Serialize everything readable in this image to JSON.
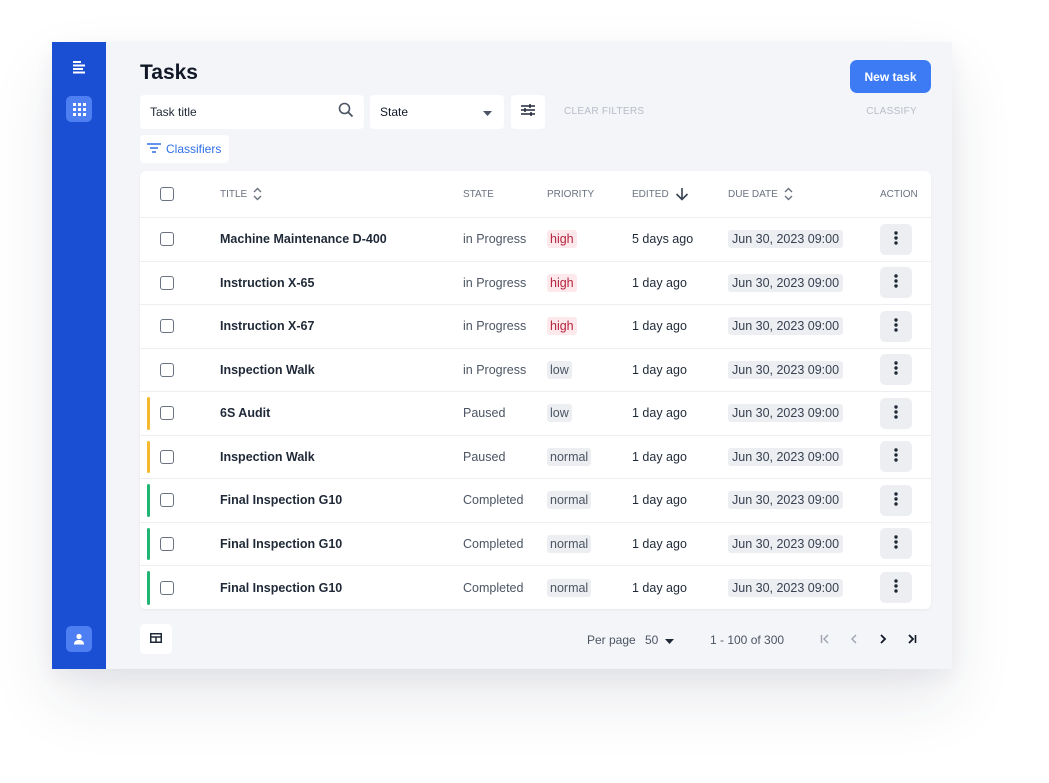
{
  "app": {
    "page_title": "Tasks",
    "new_task_label": "New task",
    "colors": {
      "accent": "#3d7bf5",
      "sidebar": "#1a4fd3",
      "paused": "#f5b82e",
      "completed": "#21b573"
    }
  },
  "sidebar": {
    "icons": [
      "menu-icon",
      "apps-icon",
      "user-icon"
    ]
  },
  "toolbar": {
    "search_placeholder": "Task title",
    "state_select_value": "State",
    "clear_filters_label": "CLEAR FILTERS",
    "classify_label": "CLASSIFY",
    "classifiers_label": "Classifiers"
  },
  "table": {
    "headers": {
      "title": "TITLE",
      "state": "STATE",
      "priority": "PRIORITY",
      "edited": "EDITED",
      "due_date": "DUE DATE",
      "action": "ACTION"
    },
    "rows": [
      {
        "title": "Machine Maintenance D-400",
        "state": "in Progress",
        "priority": "high",
        "edited": "5 days ago",
        "due": "Jun 30, 2023 09:00",
        "status": ""
      },
      {
        "title": "Instruction X-65",
        "state": "in Progress",
        "priority": "high",
        "edited": "1 day ago",
        "due": "Jun 30, 2023 09:00",
        "status": ""
      },
      {
        "title": "Instruction X-67",
        "state": "in Progress",
        "priority": "high",
        "edited": "1 day ago",
        "due": "Jun 30, 2023 09:00",
        "status": ""
      },
      {
        "title": "Inspection Walk",
        "state": "in Progress",
        "priority": "low",
        "edited": "1 day ago",
        "due": "Jun 30, 2023 09:00",
        "status": ""
      },
      {
        "title": "6S Audit",
        "state": "Paused",
        "priority": "low",
        "edited": "1 day ago",
        "due": "Jun 30, 2023 09:00",
        "status": "paused"
      },
      {
        "title": "Inspection Walk",
        "state": "Paused",
        "priority": "normal",
        "edited": "1 day ago",
        "due": "Jun 30, 2023 09:00",
        "status": "paused"
      },
      {
        "title": "Final Inspection G10",
        "state": "Completed",
        "priority": "normal",
        "edited": "1 day ago",
        "due": "Jun 30, 2023 09:00",
        "status": "completed"
      },
      {
        "title": "Final Inspection G10",
        "state": "Completed",
        "priority": "normal",
        "edited": "1 day ago",
        "due": "Jun 30, 2023 09:00",
        "status": "completed"
      },
      {
        "title": "Final Inspection G10",
        "state": "Completed",
        "priority": "normal",
        "edited": "1 day ago",
        "due": "Jun 30, 2023 09:00",
        "status": "completed"
      }
    ]
  },
  "pagination": {
    "per_page_label": "Per page",
    "per_page_value": "50",
    "range_label": "1 - 100 of 300",
    "buttons": [
      "first-page-icon",
      "prev-page-icon",
      "next-page-icon",
      "last-page-icon"
    ]
  }
}
